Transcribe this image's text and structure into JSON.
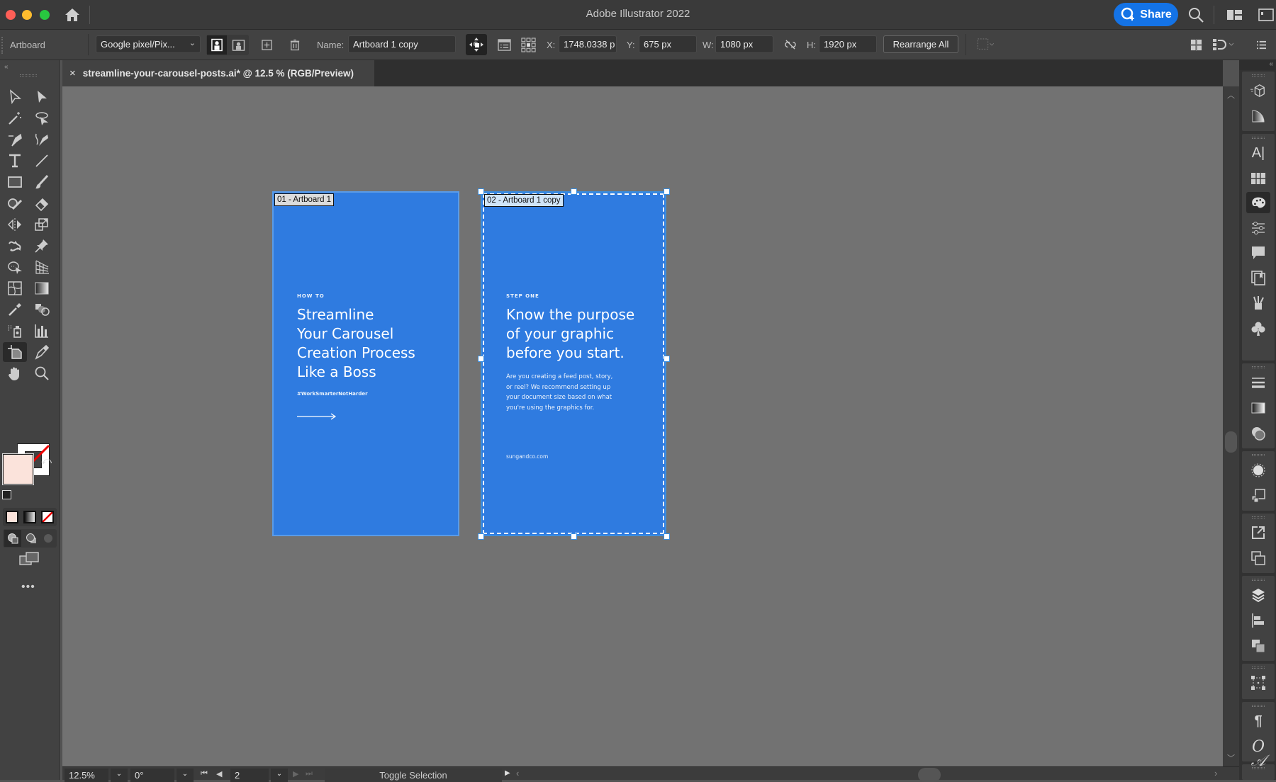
{
  "window": {
    "title": "Adobe Illustrator 2022",
    "share_label": "Share",
    "traffic_colors": [
      "#fe5f57",
      "#febc2e",
      "#28c840"
    ]
  },
  "control_bar": {
    "context_label": "Artboard",
    "preset_value": "Google pixel/Pix...",
    "name_label": "Name:",
    "name_value": "Artboard 1 copy",
    "x_label": "X:",
    "x_value": "1748.0338 p",
    "y_label": "Y:",
    "y_value": "675 px",
    "w_label": "W:",
    "w_value": "1080 px",
    "h_label": "H:",
    "h_value": "1920 px",
    "rearrange_label": "Rearrange All"
  },
  "document_tab": {
    "title": "streamline-your-carousel-posts.ai* @ 12.5 % (RGB/Preview)",
    "close_glyph": "×"
  },
  "toolbar": {
    "fill_color": "#fbe3db",
    "stroke": "none"
  },
  "artboards": [
    {
      "label": "01 - Artboard 1",
      "selected": false,
      "kicker": "HOW TO",
      "headline": [
        "Streamline",
        "Your Carousel",
        "Creation Process",
        "Like a Boss"
      ],
      "hashtag": "#WorkSmarterNotHarder",
      "arrow": "⟶",
      "background": "#2f7be0"
    },
    {
      "label": "02 - Artboard 1 copy",
      "selected": true,
      "kicker": "STEP ONE",
      "headline": [
        "Know the purpose",
        "of your graphic",
        "before you start."
      ],
      "body": [
        "Are you creating a feed post, story,",
        "or reel? We recommend setting up",
        "your document size based on what",
        "you're using the graphics for."
      ],
      "footer": "sungandco.com",
      "background": "#2f7be0"
    }
  ],
  "status_bar": {
    "zoom_value": "12.5%",
    "rotation_value": "0°",
    "artboard_number": "2",
    "status_text": "Toggle Selection"
  }
}
